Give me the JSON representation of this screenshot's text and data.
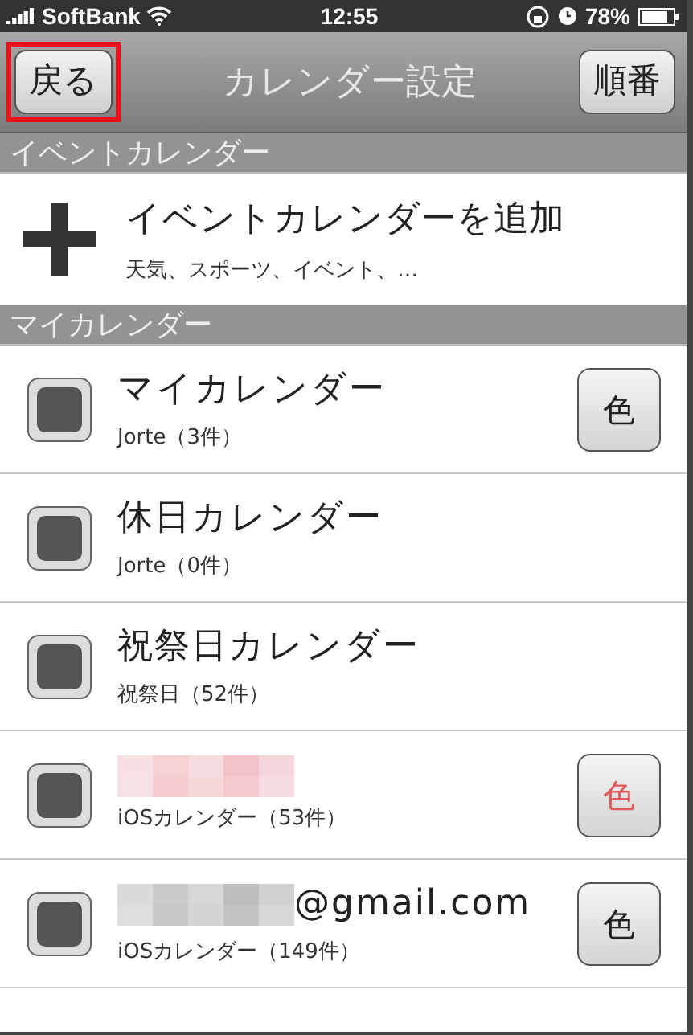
{
  "status_bar": {
    "carrier": "SoftBank",
    "time": "12:55",
    "battery": "78%"
  },
  "nav_bar": {
    "back_button": {
      "label": "戻る",
      "highlighted": true
    },
    "title": "カレンダー設定",
    "order_button": "順番"
  },
  "sections": [
    {
      "header": "イベントカレンダー",
      "kind": "add",
      "add_row": {
        "title": "イベントカレンダーを追加",
        "subtitle": "天気、スポーツ、イベント、…"
      }
    },
    {
      "header": "マイカレンダー",
      "kind": "list",
      "rows": [
        {
          "title": "マイカレンダー",
          "subtitle": "Jorte（3件）",
          "checked": false,
          "color_button": {
            "label": "色",
            "color": "#222222"
          }
        },
        {
          "title": "休日カレンダー",
          "subtitle": "Jorte（0件）",
          "checked": false
        },
        {
          "title": "祝祭日カレンダー",
          "subtitle": "祝祭日（52件）",
          "checked": false
        },
        {
          "mosaic": {
            "color": "#f2c4ca"
          },
          "subtitle": "iOSカレンダー（53件）",
          "checked": false,
          "color_button": {
            "label": "色",
            "color": "#e05a5a"
          }
        },
        {
          "mosaic": {
            "color": "#bdbdbd"
          },
          "title": "@gmail.com",
          "subtitle": "iOSカレンダー（149件）",
          "checked": false,
          "color_button": {
            "label": "色",
            "color": "#222222"
          }
        }
      ]
    }
  ]
}
